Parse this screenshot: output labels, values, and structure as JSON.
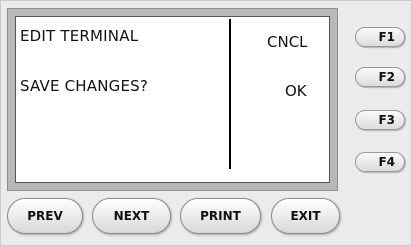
{
  "screen": {
    "line1": "EDIT TERMINAL",
    "line2": "SAVE CHANGES?",
    "option1": "CNCL",
    "option2": "OK"
  },
  "function_keys": [
    "F1",
    "F2",
    "F3",
    "F4"
  ],
  "nav_buttons": {
    "prev": "PREV",
    "next": "NEXT",
    "print": "PRINT",
    "exit": "EXIT"
  }
}
